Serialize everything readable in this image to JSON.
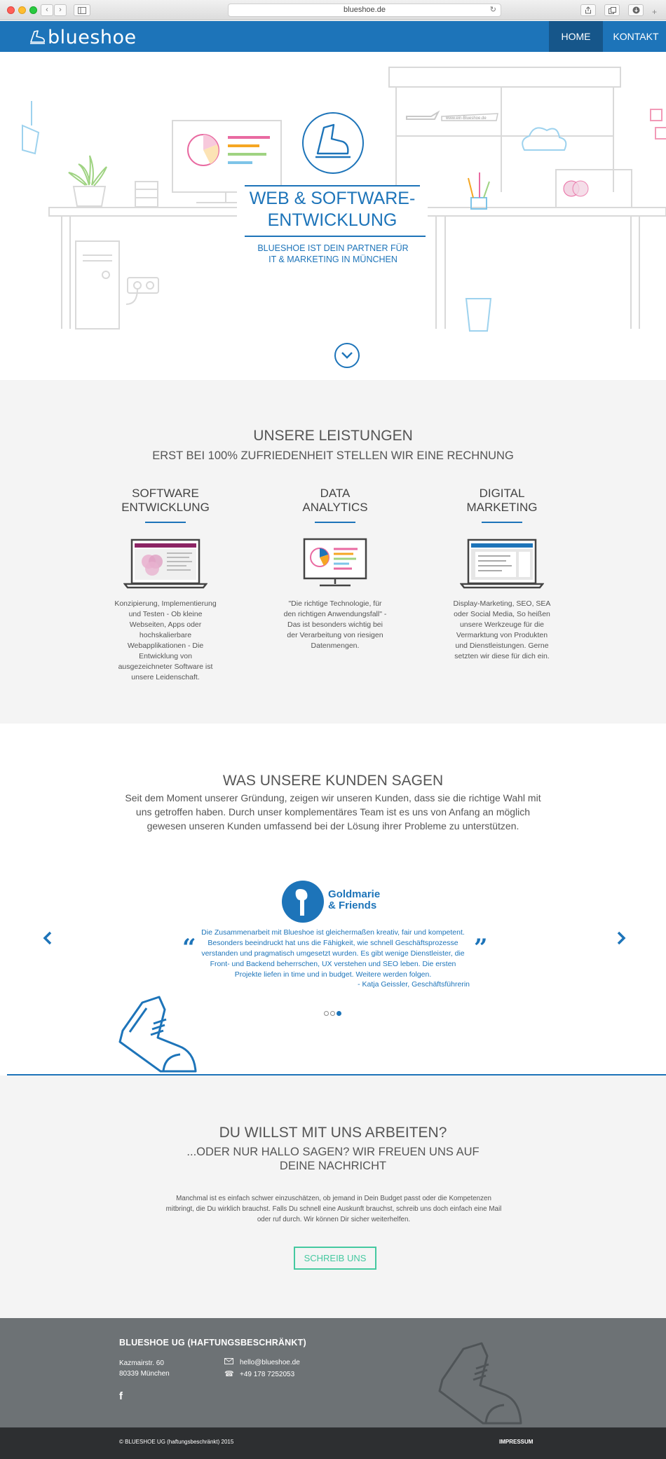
{
  "browser": {
    "url": "blueshoe.de",
    "back_label": "‹",
    "forward_label": "›"
  },
  "nav": {
    "logo_text": "blueshoe",
    "home_label": "HOME",
    "kontakt_label": "KONTAKT",
    "brand_color": "#1d74b9",
    "active_color": "#16568a"
  },
  "hero": {
    "title_line1": "WEB & SOFTWARE-",
    "title_line2": "ENTWICKLUNG",
    "subtitle_line1": "BLUESHOE IST DEIN PARTNER FÜR",
    "subtitle_line2": "IT & MARKETING IN MÜNCHEN",
    "scroll_icon": "chevron-down-icon",
    "banner_text": "www.ein-Blueshoe.de"
  },
  "leistungen": {
    "title": "UNSERE LEISTUNGEN",
    "subtitle": "ERST BEI 100% ZUFRIEDENHEIT STELLEN WIR EINE RECHNUNG",
    "items": [
      {
        "title_line1": "SOFTWARE",
        "title_line2": "ENTWICKLUNG",
        "icon": "laptop-venn-icon",
        "text": "Konzipierung, Implementierung und Testen - Ob kleine Webseiten, Apps oder hochskalierbare Webapplikationen - Die Entwicklung von ausgezeichneter Software ist unsere Leidenschaft."
      },
      {
        "title_line1": "DATA",
        "title_line2": "ANALYTICS",
        "icon": "monitor-chart-icon",
        "text": "\"Die richtige Technologie, für den richtigen Anwendungsfall\" - Das ist besonders wichtig bei der Verarbeitung von riesigen Datenmengen."
      },
      {
        "title_line1": "DIGITAL",
        "title_line2": "MARKETING",
        "icon": "laptop-browser-icon",
        "text": "Display-Marketing, SEO, SEA oder Social Media, So heißen unsere Werkzeuge für die Vermarktung von Produkten und Dienstleistungen. Gerne setzten wir diese für dich ein."
      }
    ]
  },
  "kunden": {
    "title": "WAS UNSERE KUNDEN SAGEN",
    "text": "Seit dem Moment unserer Gründung, zeigen wir unseren Kunden, dass sie die richtige Wahl mit uns getroffen haben. Durch unser komplementäres Team ist es uns von Anfang an möglich gewesen unseren Kunden umfassend bei der Lösung ihrer Probleme zu unterstützen.",
    "client_name_line1": "Goldmarie",
    "client_name_line2": "& Friends",
    "quote": "Die Zusammenarbeit mit Blueshoe ist gleichermaßen kreativ, fair und kompetent. Besonders beeindruckt hat uns die Fähigkeit, wie schnell Geschäftsprozesse verstanden und pragmatisch umgesetzt wurden. Es gibt wenige Dienstleister, die Front- und Backend beherrschen, UX verstehen und SEO leben. Die ersten Projekte liefen in time und in budget. Weitere werden folgen.",
    "author": "- Katja Geissler, Geschäftsführerin",
    "open_quote": "“",
    "close_quote": "”",
    "prev_label": "‹",
    "next_label": "›",
    "slides_total": 3,
    "slide_active": 3
  },
  "arbeiten": {
    "title": "DU WILLST MIT UNS ARBEITEN?",
    "subtitle_line1": "...ODER NUR HALLO SAGEN? WIR FREUEN UNS AUF",
    "subtitle_line2": "DEINE NACHRICHT",
    "text": "Manchmal ist es einfach schwer einzuschätzen, ob jemand in Dein Budget passt oder die Kompetenzen mitbringt, die Du wirklich brauchst. Falls Du schnell eine Auskunft brauchst, schreib uns doch einfach eine Mail oder ruf durch. Wir können Dir sicher weiterhelfen.",
    "button_label": "SCHREIB UNS",
    "button_color": "#45c9a0"
  },
  "footer": {
    "company": "BLUESHOE UG (HAFTUNGSBESCHRÄNKT)",
    "street": "Kazmairstr. 60",
    "city": "80339 München",
    "email": "hello@blueshoe.de",
    "phone": "+49 178 7252053",
    "facebook_label": "f",
    "copyright": "© BLUESHOE UG (haftungsbeschränkt) 2015",
    "impressum_label": "IMPRESSUM"
  }
}
